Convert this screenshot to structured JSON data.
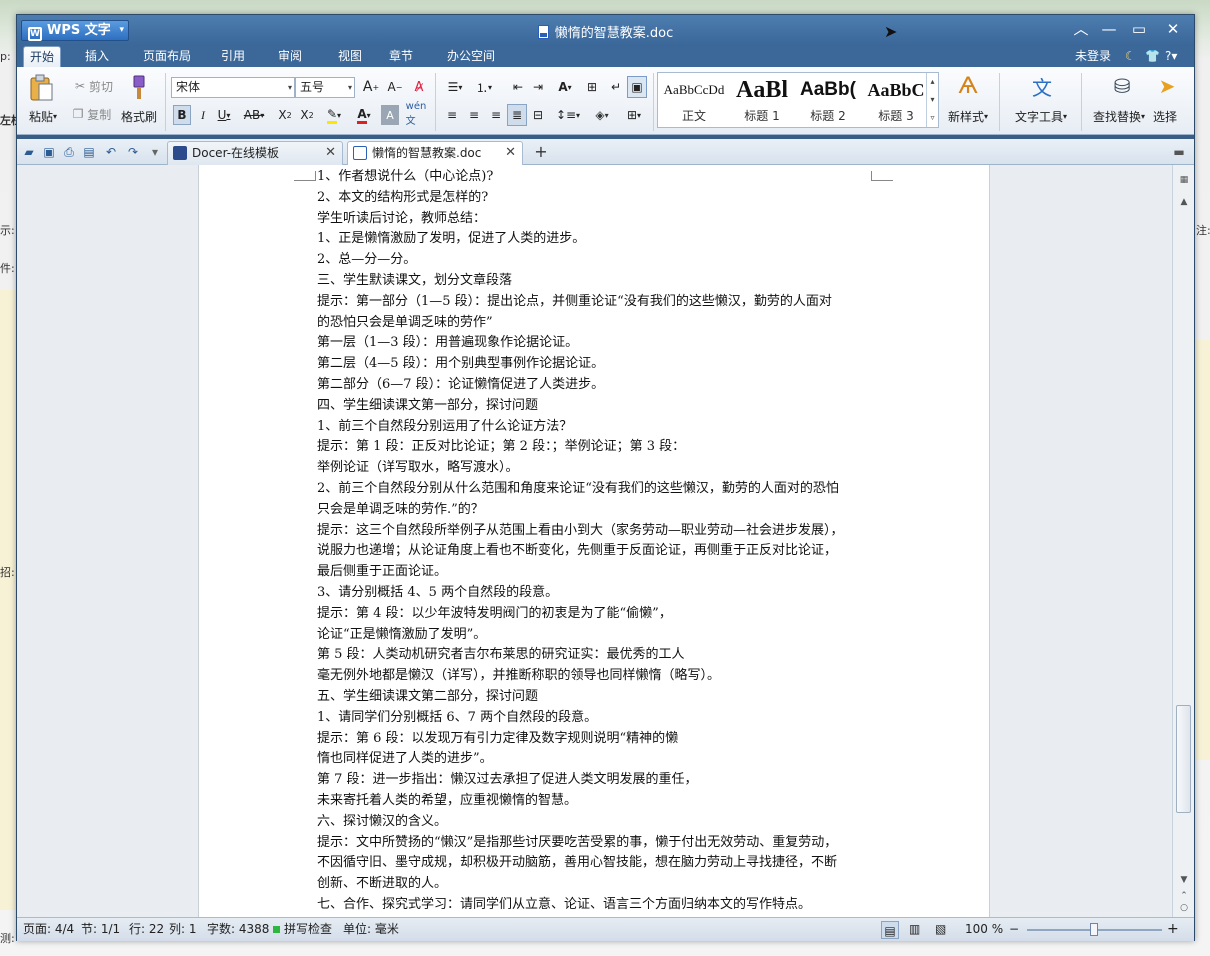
{
  "app": {
    "name": "WPS 文字",
    "window_title": "懒惰的智慧教案.doc"
  },
  "menu": [
    {
      "label": "开始",
      "active": true
    },
    {
      "label": "插入"
    },
    {
      "label": "页面布局"
    },
    {
      "label": "引用"
    },
    {
      "label": "审阅"
    },
    {
      "label": "视图"
    },
    {
      "label": "章节"
    },
    {
      "label": "办公空间"
    }
  ],
  "account": {
    "login": "未登录"
  },
  "ribbon": {
    "paste": "粘贴",
    "cut": "剪切",
    "copy": "复制",
    "format_painter": "格式刷",
    "font_name": "宋体",
    "font_size": "五号",
    "styles": [
      {
        "preview": "AaBbCcDd",
        "label": "正文"
      },
      {
        "preview": "AaBl",
        "label": "标题 1"
      },
      {
        "preview": "AaBb(",
        "label": "标题 2"
      },
      {
        "preview": "AaBbC",
        "label": "标题 3"
      }
    ],
    "new_style": "新样式",
    "text_tools": "文字工具",
    "find_replace": "查找替换",
    "select": "选择"
  },
  "tabs": [
    {
      "label": "Docer-在线模板",
      "active": false
    },
    {
      "label": "懒惰的智慧教案.doc",
      "active": true
    }
  ],
  "document_lines": [
    "1、作者想说什么（中心论点)?",
    "2、本文的结构形式是怎样的?",
    "学生听读后讨论，教师总结：",
    "1、正是懒惰激励了发明，促进了人类的进步。",
    "2、总—分—分。",
    "三、学生默读课文，划分文章段落",
    "提示：第一部分（1—5 段）：提出论点，并侧重论证“没有我们的这些懒汉，勤劳的人面对",
    "的恐怕只会是单调乏味的劳作”",
    "第一层（1—3 段）：用普遍现象作论据论证。",
    "第二层（4—5 段）：用个别典型事例作论据论证。",
    "第二部分（6—7 段）：论证懒惰促进了人类进步。",
    "四、学生细读课文第一部分，探讨问题",
    "1、前三个自然段分别运用了什么论证方法？",
    "提示：第 1 段：正反对比论证；第 2 段：；举例论证；第 3 段：",
    "举例论证（详写取水，略写渡水）。",
    "2、前三个自然段分别从什么范围和角度来论证“没有我们的这些懒汉，勤劳的人面对的恐怕",
    "只会是单调乏味的劳作.”的？",
    "提示：这三个自然段所举例子从范围上看由小到大（家务劳动—职业劳动—社会进步发展），",
    "说服力也递增；从论证角度上看也不断变化，先侧重于反面论证，再侧重于正反对比论证，",
    "最后侧重于正面论证。",
    "3、请分别概括 4、5 两个自然段的段意。",
    "提示：第 4 段：以少年波特发明阀门的初衷是为了能“偷懒”，",
    "论证“正是懒惰激励了发明”。",
    "第 5 段：人类动机研究者吉尔布莱思的研究证实：最优秀的工人",
    "毫无例外地都是懒汉（详写），并推断称职的领导也同样懒惰（略写）。",
    "五、学生细读课文第二部分，探讨问题",
    "1、请同学们分别概括 6、7 两个自然段的段意。",
    "提示：第 6 段：以发现万有引力定律及数字规则说明“精神的懒",
    "惰也同样促进了人类的进步”。",
    "第 7 段：进一步指出：懒汉过去承担了促进人类文明发展的重任，",
    "未来寄托着人类的希望，应重视懒惰的智慧。",
    "六、探讨懒汉的含义。",
    "提示：文中所赞扬的“懒汉”是指那些讨厌要吃苦受累的事，懒于付出无效劳动、重复劳动，",
    "不因循守旧、墨守成规，却积极开动脑筋，善用心智技能，想在脑力劳动上寻找捷径，不断",
    "创新、不断进取的人。",
    "七、合作、探究式学习：请同学们从立意、论证、语言三个方面归纳本文的写作特点。"
  ],
  "status": {
    "page": "页面: 4/4",
    "section": "节: 1/1",
    "row": "行: 22",
    "col": "列: 1",
    "words": "字数: 4388",
    "spell": "拼写检查",
    "unit": "单位: 毫米",
    "zoom": "100 %"
  },
  "background": {
    "left_fragments": [
      "p:",
      "左栏",
      "示:",
      "件:",
      "招:",
      "测:"
    ],
    "right_fragments": [
      "注:"
    ]
  }
}
